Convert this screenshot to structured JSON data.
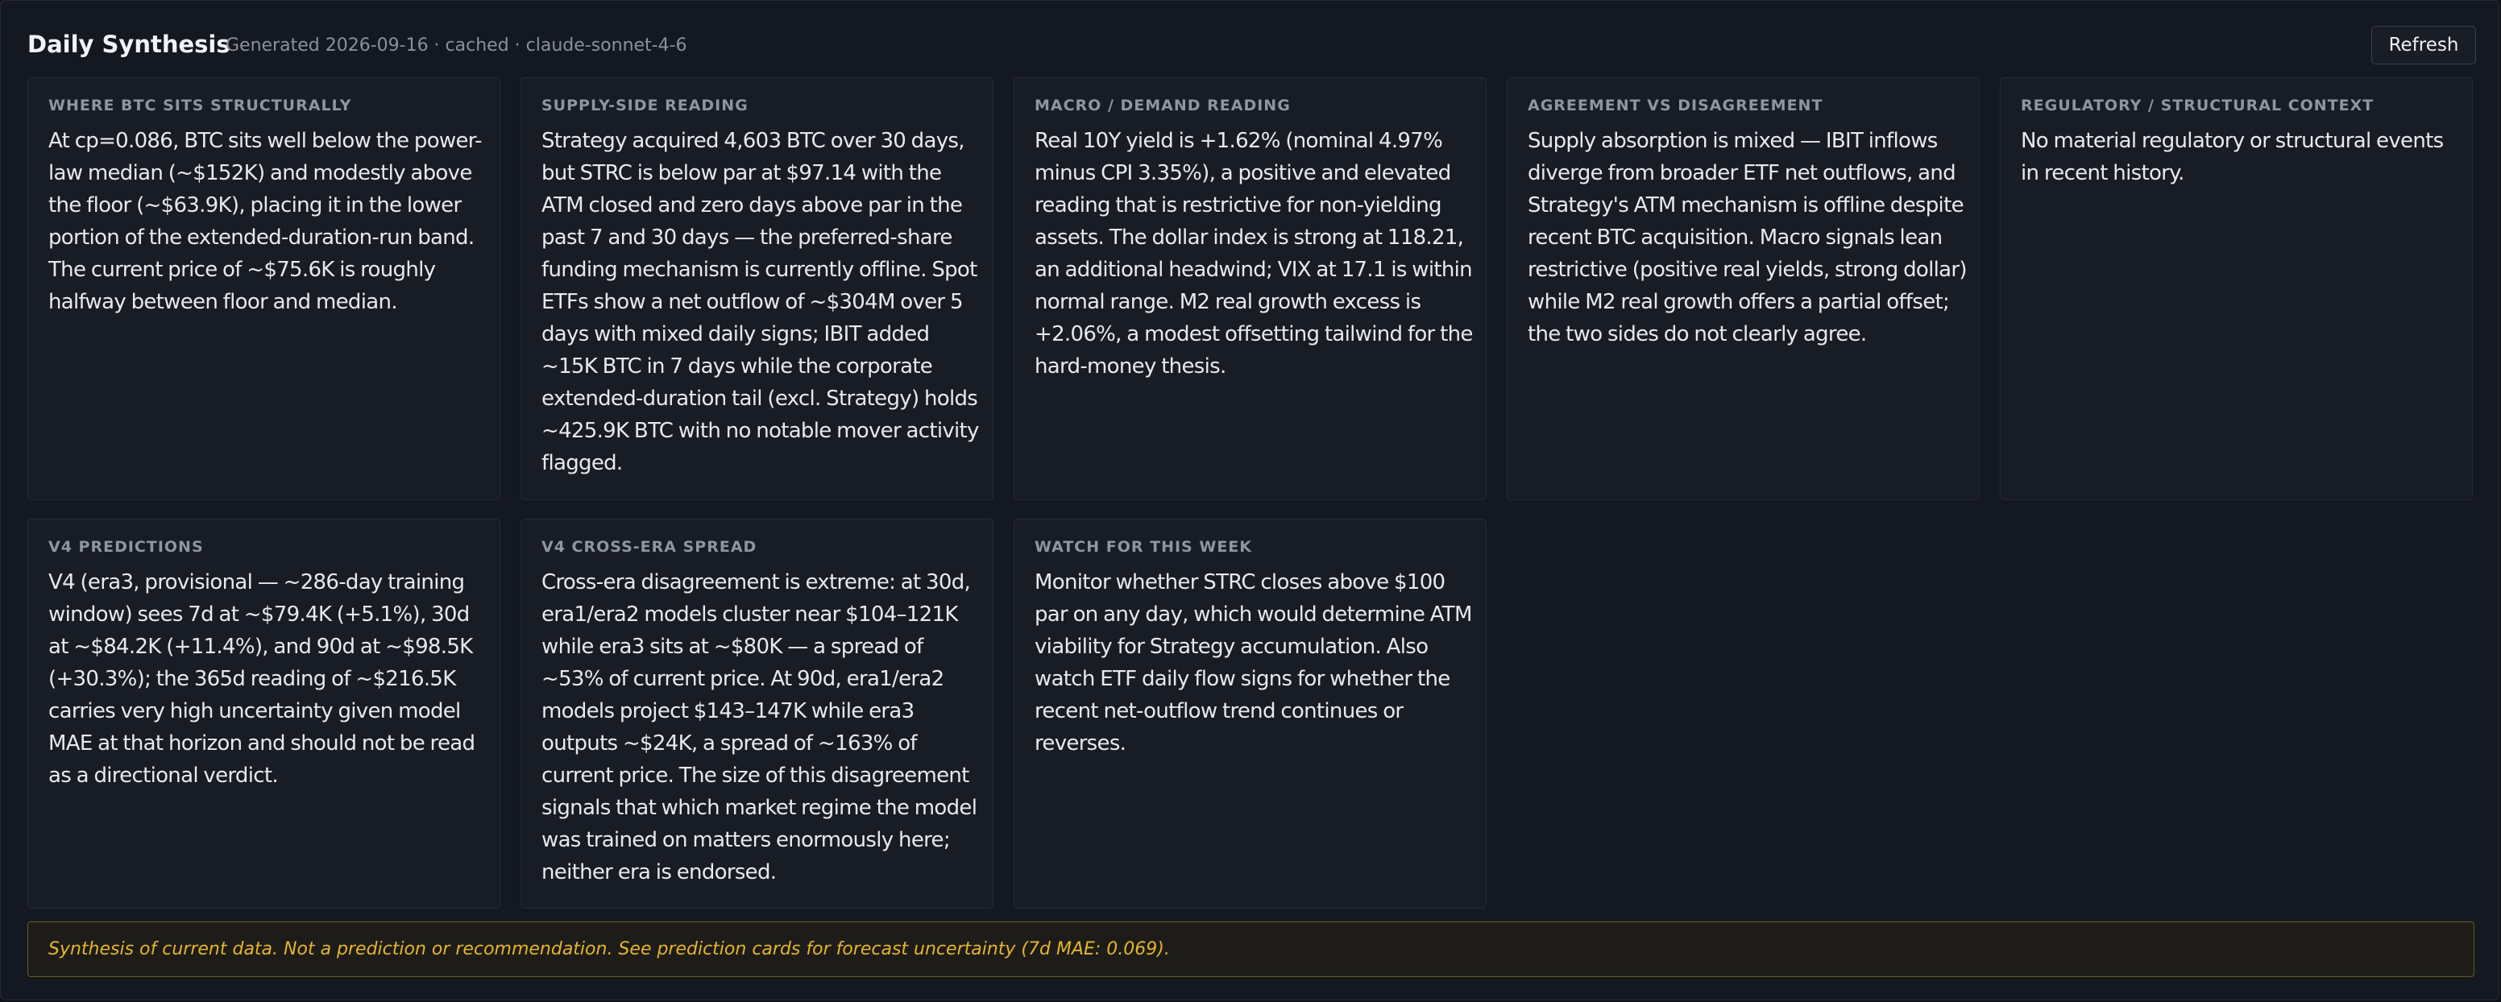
{
  "header": {
    "title": "Daily Synthesis",
    "subtitle": "Generated 2026-09-16 · cached · claude-sonnet-4-6",
    "refresh_label": "Refresh"
  },
  "cards": [
    {
      "heading": "WHERE BTC SITS STRUCTURALLY",
      "body": "At cp=0.086, BTC sits well below the power-law median (~$152K) and modestly above the floor (~$63.9K), placing it in the lower portion of the extended-duration-run band. The current price of ~$75.6K is roughly halfway between floor and median."
    },
    {
      "heading": "SUPPLY-SIDE READING",
      "body": "Strategy acquired 4,603 BTC over 30 days, but STRC is below par at $97.14 with the ATM closed and zero days above par in the past 7 and 30 days — the preferred-share funding mechanism is currently offline. Spot ETFs show a net outflow of ~$304M over 5 days with mixed daily signs; IBIT added ~15K BTC in 7 days while the corporate extended-duration tail (excl. Strategy) holds ~425.9K BTC with no notable mover activity flagged."
    },
    {
      "heading": "MACRO / DEMAND READING",
      "body": "Real 10Y yield is +1.62% (nominal 4.97% minus CPI 3.35%), a positive and elevated reading that is restrictive for non-yielding assets. The dollar index is strong at 118.21, an additional headwind; VIX at 17.1 is within normal range. M2 real growth excess is +2.06%, a modest offsetting tailwind for the hard-money thesis."
    },
    {
      "heading": "AGREEMENT VS DISAGREEMENT",
      "body": "Supply absorption is mixed — IBIT inflows diverge from broader ETF net outflows, and Strategy's ATM mechanism is offline despite recent BTC acquisition. Macro signals lean restrictive (positive real yields, strong dollar) while M2 real growth offers a partial offset; the two sides do not clearly agree."
    },
    {
      "heading": "REGULATORY / STRUCTURAL CONTEXT",
      "body": "No material regulatory or structural events in recent history."
    },
    {
      "heading": "V4 PREDICTIONS",
      "body": "V4 (era3, provisional — ~286-day training window) sees 7d at ~$79.4K (+5.1%), 30d at ~$84.2K (+11.4%), and 90d at ~$98.5K (+30.3%); the 365d reading of ~$216.5K carries very high uncertainty given model MAE at that horizon and should not be read as a directional verdict."
    },
    {
      "heading": "V4 CROSS-ERA SPREAD",
      "body": "Cross-era disagreement is extreme: at 30d, era1/era2 models cluster near $104–121K while era3 sits at ~$80K — a spread of ~53% of current price. At 90d, era1/era2 models project $143–147K while era3 outputs ~$24K, a spread of ~163% of current price. The size of this disagreement signals that which market regime the model was trained on matters enormously here; neither era is endorsed."
    },
    {
      "heading": "WATCH FOR THIS WEEK",
      "body": "Monitor whether STRC closes above $100 par on any day, which would determine ATM viability for Strategy accumulation. Also watch ETF daily flow signs for whether the recent net-outflow trend continues or reverses."
    }
  ],
  "footer": {
    "disclaimer": "Synthesis of current data. Not a prediction or recommendation. See prediction cards for forecast uncertainty (7d MAE: 0.069)."
  }
}
